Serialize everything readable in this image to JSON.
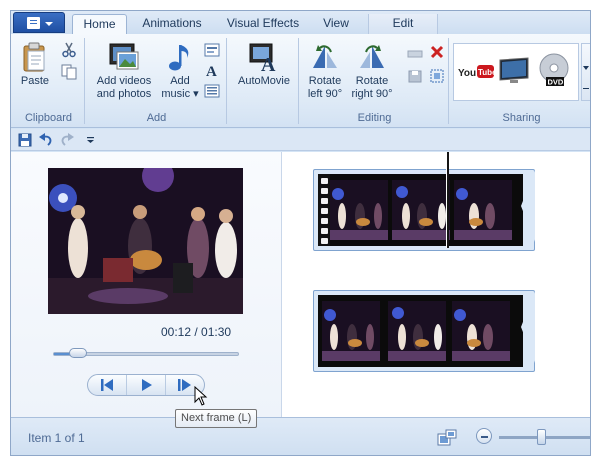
{
  "tabs": [
    {
      "label": "Home",
      "active": true
    },
    {
      "label": "Animations",
      "active": false
    },
    {
      "label": "Visual Effects",
      "active": false
    },
    {
      "label": "View",
      "active": false
    },
    {
      "label": "Edit",
      "active": false,
      "contextual": true
    }
  ],
  "ribbon": {
    "clipboard": {
      "group_label": "Clipboard",
      "paste_label": "Paste",
      "icons": [
        "paste-icon",
        "cut-icon",
        "copy-icon"
      ]
    },
    "add": {
      "group_label": "Add",
      "add_videos_line1": "Add videos",
      "add_videos_line2": "and photos",
      "add_music_line1": "Add",
      "add_music_line2": "music",
      "icons": [
        "title-icon",
        "caption-icon",
        "credits-icon"
      ]
    },
    "automovie": {
      "label": "AutoMovie"
    },
    "editing": {
      "group_label": "Editing",
      "rotate_left_line1": "Rotate",
      "rotate_left_line2": "left 90°",
      "rotate_right_line1": "Rotate",
      "rotate_right_line2": "right 90°",
      "icons": [
        "remove-icon",
        "select-all-icon",
        "snapshot-icon",
        "trim-icon"
      ]
    },
    "sharing": {
      "group_label": "Sharing",
      "items": [
        "youtube-icon",
        "monitor-icon",
        "dvd-icon"
      ],
      "youtube_text": "YouTube",
      "dvd_text": "DVD"
    }
  },
  "qat": {
    "icons": [
      "save-icon",
      "undo-icon",
      "redo-icon",
      "customize-dropdown-icon"
    ]
  },
  "preview": {
    "time_display": "00:12 / 01:30",
    "seek_progress": 0.133
  },
  "playback": {
    "buttons": [
      "previous-frame",
      "play",
      "next-frame"
    ],
    "tooltip": "Next frame (L)"
  },
  "status": {
    "item_text": "Item 1 of 1",
    "zoom_level": 0.4
  },
  "colors": {
    "accent": "#2b5797",
    "ribbon_bg": "#dde9f6",
    "youtube_red": "#cc181e"
  }
}
